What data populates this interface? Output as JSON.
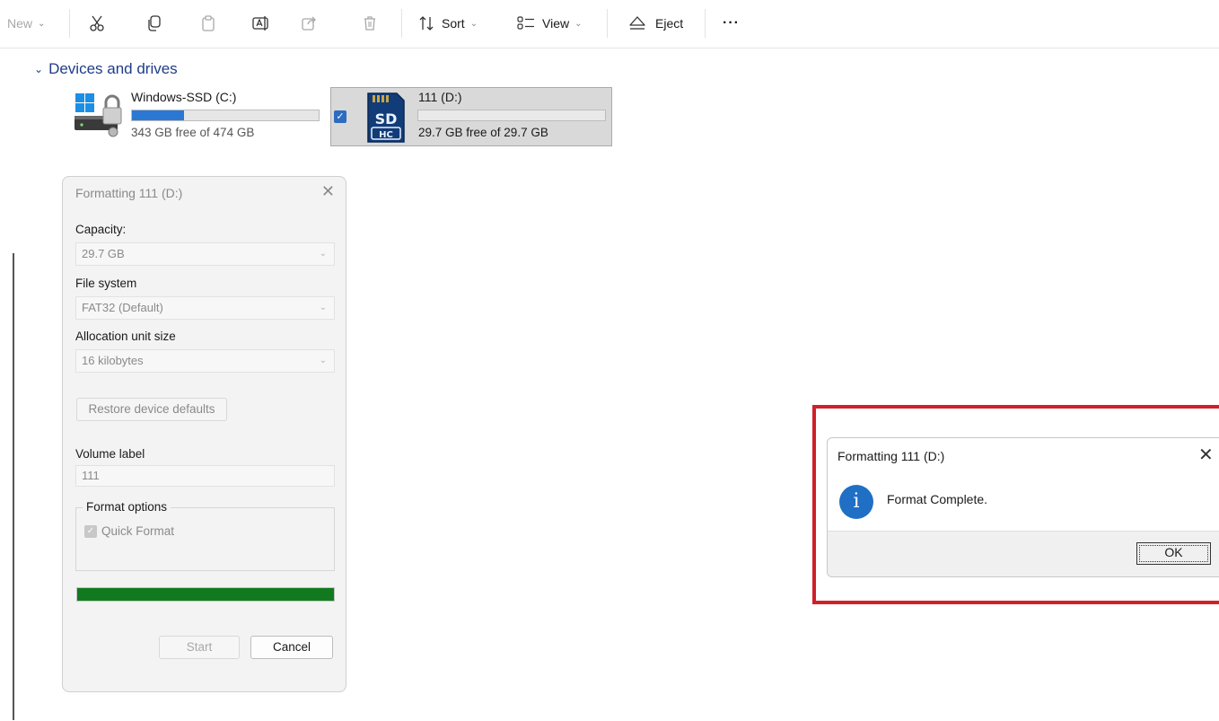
{
  "toolbar": {
    "new_label": "New",
    "sort_label": "Sort",
    "view_label": "View",
    "eject_label": "Eject",
    "more_label": "···"
  },
  "devices": {
    "heading": "Devices and drives",
    "drives": [
      {
        "name": "Windows-SSD (C:)",
        "free_text": "343 GB free of 474 GB",
        "used_fraction": 0.28,
        "icon": "hard-drive-windows-icon"
      },
      {
        "name": "111 (D:)",
        "free_text": "29.7 GB free of 29.7 GB",
        "used_fraction": 0.0,
        "icon": "sd-card-icon",
        "selected": true
      }
    ]
  },
  "format_dialog": {
    "title": "Formatting 111 (D:)",
    "capacity_label": "Capacity:",
    "capacity_value": "29.7 GB",
    "filesystem_label": "File system",
    "filesystem_value": "FAT32 (Default)",
    "allocation_label": "Allocation unit size",
    "allocation_value": "16 kilobytes",
    "restore_label": "Restore device defaults",
    "volume_label_label": "Volume label",
    "volume_label_value": "111",
    "format_options_label": "Format options",
    "quick_format_label": "Quick Format",
    "progress_fraction": 1.0,
    "start_label": "Start",
    "cancel_label": "Cancel"
  },
  "message_box": {
    "title": "Formatting 111 (D:)",
    "message": "Format Complete.",
    "ok_label": "OK",
    "icon": "info-icon"
  },
  "colors": {
    "accent": "#2b78d4",
    "progress": "#117a1e",
    "highlight": "#d0202a",
    "info": "#1f6fc5"
  }
}
